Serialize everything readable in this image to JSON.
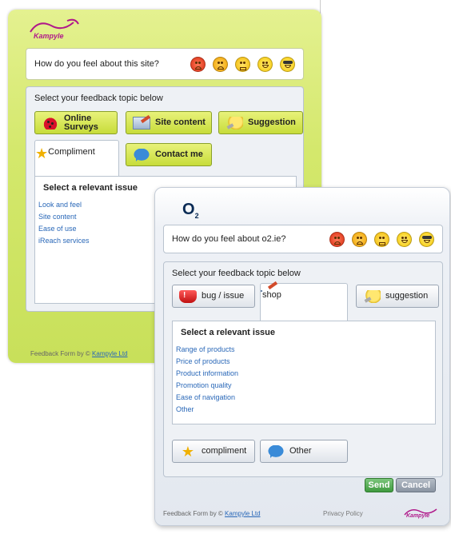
{
  "back_widget": {
    "logo_text": "Kampyle",
    "rating_question": "How do you feel about this site?",
    "topic_title": "Select your feedback topic below",
    "buttons": {
      "online_surveys": "Online Surveys",
      "site_content": "Site content",
      "suggestion": "Suggestion",
      "compliment": "Compliment",
      "contact_me": "Contact me"
    },
    "issue_title": "Select a relevant issue",
    "issues": [
      "Look and feel",
      "Site content",
      "Ease of use",
      "iReach services"
    ],
    "footer_prefix": "Feedback Form by ©",
    "footer_link": "Kampyle Ltd"
  },
  "front_widget": {
    "logo_text": "O",
    "logo_sub": "2",
    "rating_question": "How do you feel about o2.ie?",
    "topic_title": "Select your feedback topic below",
    "buttons": {
      "bug_issue": "bug / issue",
      "shop": "shop",
      "suggestion": "suggestion",
      "compliment": "compliment",
      "other": "Other"
    },
    "issue_title": "Select a relevant issue",
    "issues": [
      "Range of products",
      "Price of products",
      "Product information",
      "Promotion quality",
      "Ease of navigation",
      "Other"
    ],
    "send_label": "Send",
    "cancel_label": "Cancel",
    "footer_prefix": "Feedback Form by ©",
    "footer_link": "Kampyle Ltd",
    "privacy_label": "Privacy Policy",
    "mini_logo_text": "Kampyle"
  },
  "faces": [
    "angry",
    "sad",
    "neutral",
    "happy",
    "cool"
  ],
  "colors": {
    "back_accent": "#c8e05a",
    "link": "#2a68b8",
    "send": "#3f9a3f",
    "cancel": "#8a94a2",
    "kampyle_brand": "#b0198a"
  }
}
